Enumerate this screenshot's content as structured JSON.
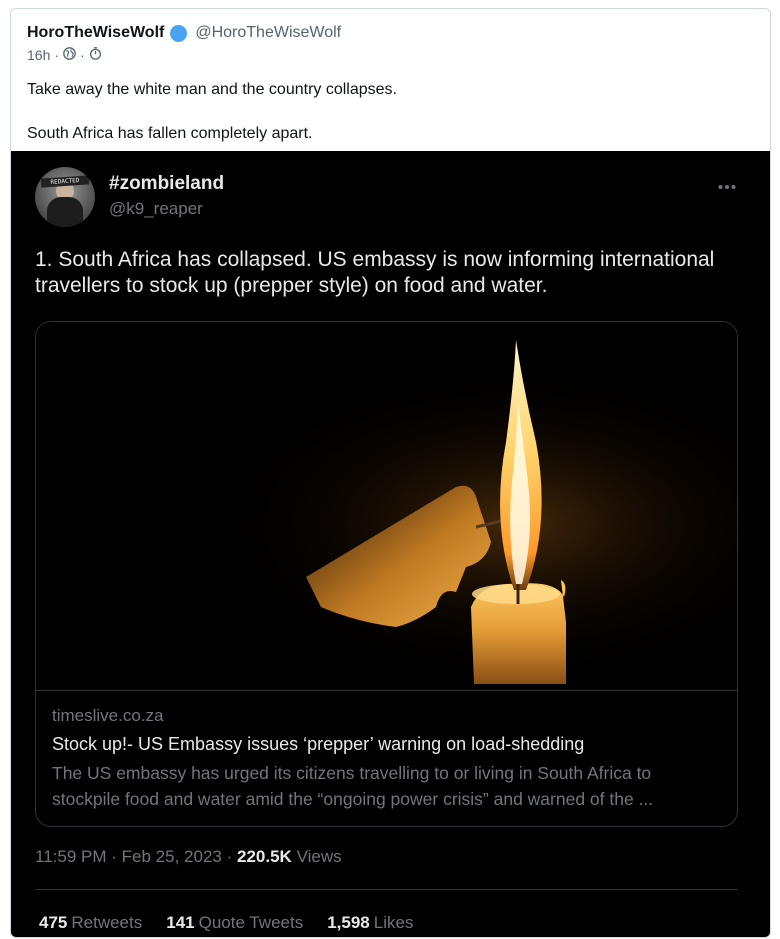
{
  "outer_post": {
    "display_name": "HoroTheWiseWolf",
    "handle": "@HoroTheWiseWolf",
    "time": "16h",
    "separator": "·",
    "text": "Take away the white man and the country collapses.\n\nSouth Africa has fallen completely apart.",
    "verified_color": "#4aa3f0"
  },
  "embedded_tweet": {
    "display_name": "#zombieland",
    "handle": "@k9_reaper",
    "avatar_label": "REDACTED",
    "more_icon": "more-horizontal-icon",
    "text": "1. South Africa has collapsed. US embassy is now informing international travellers to stock up (prepper style) on food and water.",
    "link_card": {
      "domain": "timeslive.co.za",
      "title": "Stock up!- US Embassy issues ‘prepper’ warning on load-shedding",
      "description": "The US embassy has urged its citizens travelling to or living in South Africa to stockpile food and water amid the “ongoing power crisis” and warned of the ..."
    },
    "timestamp": {
      "time": "11:59 PM",
      "separator": "·",
      "date": "Feb 25, 2023",
      "views_count": "220.5K",
      "views_label": "Views"
    },
    "stats": {
      "retweets_count": "475",
      "retweets_label": "Retweets",
      "quotes_count": "141",
      "quotes_label": "Quote Tweets",
      "likes_count": "1,598",
      "likes_label": "Likes"
    }
  }
}
